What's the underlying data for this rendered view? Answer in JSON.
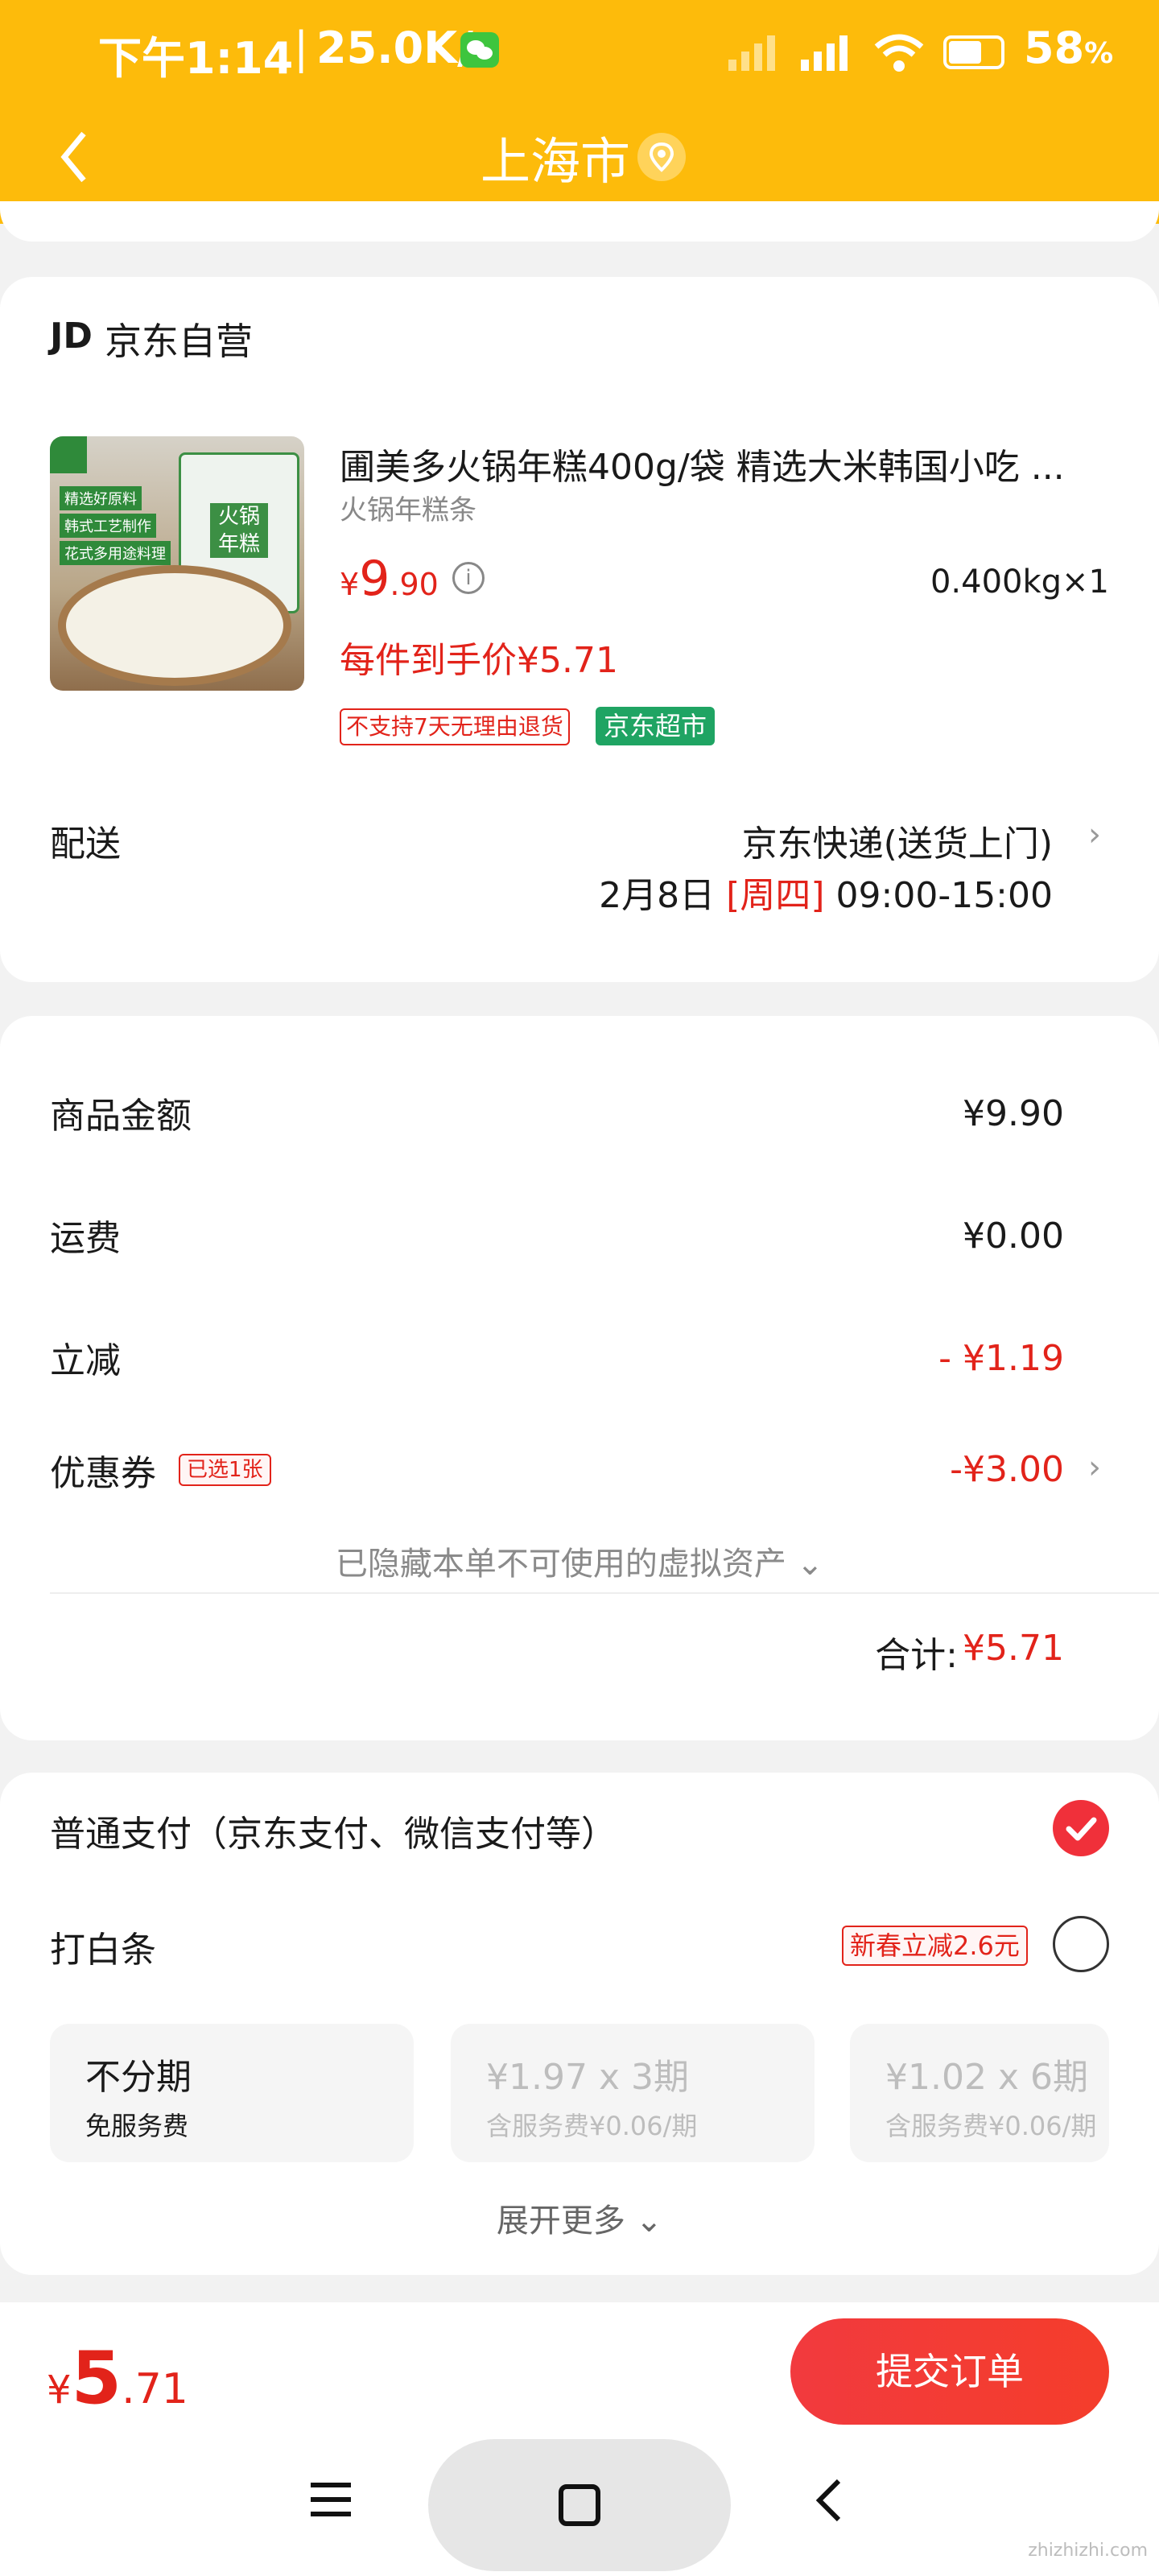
{
  "status_bar": {
    "time": "下午1:14",
    "speed": "25.0K/s",
    "battery": "58",
    "battery_unit": "%"
  },
  "nav": {
    "title": "上海市"
  },
  "store": {
    "logo": "JD",
    "name": "京东自营"
  },
  "product": {
    "title": "圃美多火锅年糕400g/袋  精选大米韩国小吃 ...",
    "subtitle": "火锅年糕条",
    "price_symbol": "¥",
    "price_int": "9",
    "price_dec": ".90",
    "weight_qty": "0.400kg×1",
    "final_price": "每件到手价¥5.71",
    "tag_return": "不支持7天无理由退货",
    "tag_market": "京东超市",
    "image_labels": [
      "精选好原料",
      "韩式工艺制作",
      "花式多用途料理",
      "火锅年糕"
    ]
  },
  "delivery": {
    "label": "配送",
    "method": "京东快递(送货上门)",
    "date": "2月8日",
    "weekday": "[周四]",
    "time": "09:00-15:00"
  },
  "summary": {
    "goods_label": "商品金额",
    "goods_value": "¥9.90",
    "freight_label": "运费",
    "freight_value": "¥0.00",
    "discount_label": "立减",
    "discount_value": "- ¥1.19",
    "coupon_label": "优惠券",
    "coupon_badge": "已选1张",
    "coupon_value": "-¥3.00",
    "hidden_note": "已隐藏本单不可使用的虚拟资产",
    "total_label": "合计:",
    "total_value": "¥5.71"
  },
  "payment": {
    "normal_label": "普通支付（京东支付、微信支付等）",
    "baitiao_label": "打白条",
    "baitiao_promo": "新春立减2.6元",
    "installments": [
      {
        "title": "不分期",
        "sub": "免服务费"
      },
      {
        "title": "¥1.97 x 3期",
        "sub": "含服务费¥0.06/期"
      },
      {
        "title": "¥1.02 x 6期",
        "sub": "含服务费¥0.06/期"
      }
    ],
    "expand_more": "展开更多"
  },
  "bottom": {
    "price_symbol": "¥",
    "price_int": "5",
    "price_dec": ".71",
    "submit_label": "提交订单"
  },
  "watermark": "zhizhizhi.com",
  "colors": {
    "header": "#fdbb0b",
    "accent_red": "#e2231a",
    "market_green": "#1fa463"
  }
}
